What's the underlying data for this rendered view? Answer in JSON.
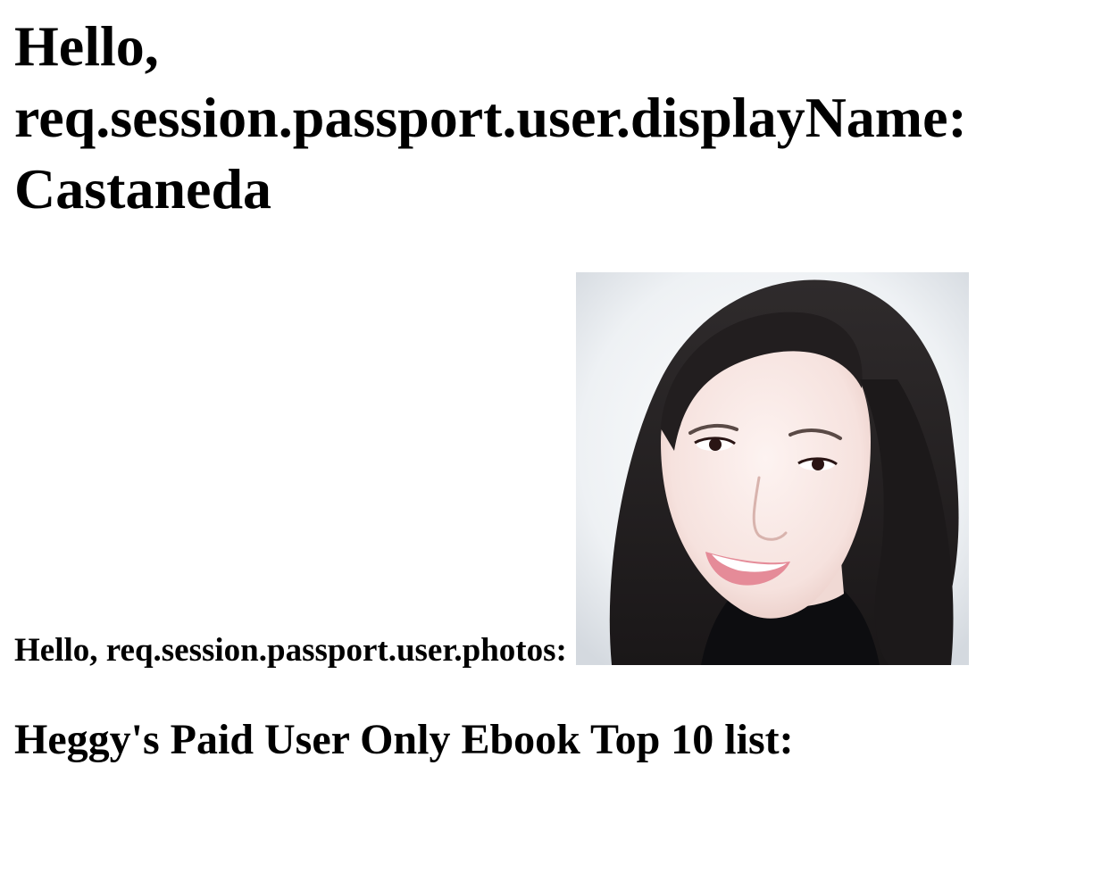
{
  "greeting": {
    "hello": "Hello,",
    "display_name_label": "req.session.passport.user.displayName:",
    "display_name_value": "Castaneda"
  },
  "photos": {
    "label": "Hello, req.session.passport.user.photos:",
    "avatar_icon": "user-photo-portrait"
  },
  "ebook": {
    "heading": "Heggy's Paid User Only Ebook Top 10 list:"
  },
  "colors": {
    "text": "#000000",
    "background": "#ffffff"
  }
}
